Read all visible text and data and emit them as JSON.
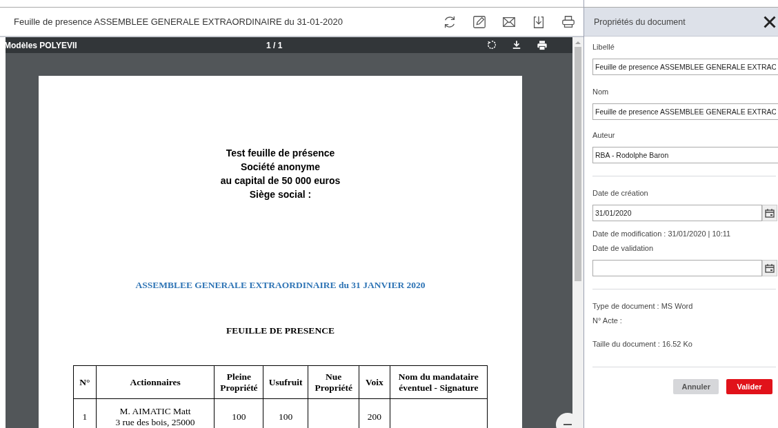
{
  "document_bar": {
    "title": "Feuille de presence ASSEMBLEE GENERALE EXTRAORDINAIRE du 31-01-2020"
  },
  "viewer": {
    "toolbar": {
      "title": "Modèles POLYEVII",
      "page_count": "1 / 1"
    },
    "page": {
      "heading_lines": [
        "Test feuille de présence",
        "Société anonyme",
        "au capital de 50 000 euros",
        "Siège social :"
      ],
      "meeting_title": "ASSEMBLEE GENERALE EXTRAORDINAIRE du 31 JANVIER 2020",
      "sheet_title": "FEUILLE DE PRESENCE",
      "table": {
        "columns": [
          "N°",
          "Actionnaires",
          "Pleine Propriété",
          "Usufruit",
          "Nue Propriété",
          "Voix",
          "Nom du mandataire éventuel - Signature"
        ],
        "rows": [
          {
            "number": "1",
            "shareholder": [
              "M. AIMATIC Matt",
              "3 rue des bois, 25000"
            ],
            "full_ownership": "100",
            "usufruct": "100",
            "votes": "200"
          }
        ]
      }
    }
  },
  "properties": {
    "title": "Propriétés du document",
    "fields": [
      {
        "label": "Libellé",
        "value": "Feuille de presence ASSEMBLEE GENERALE EXTRAC"
      },
      {
        "label": "Nom",
        "value": "Feuille de presence ASSEMBLEE GENERALE EXTRAC"
      },
      {
        "label": "Auteur",
        "value": "RBA - Rodolphe Baron"
      }
    ],
    "creation_date": {
      "label": "Date de création",
      "value": "31/01/2020"
    },
    "modification": "Date de modification : 31/01/2020 | 10:11",
    "validation_date": {
      "label": "Date de validation"
    },
    "info": [
      "Type de document : MS Word",
      "N° Acte :"
    ],
    "size": "Taille du document : 16.52 Ko",
    "buttons": [
      {
        "label": "Annuler",
        "kind": "secondary"
      },
      {
        "label": "Valider",
        "kind": "primary"
      }
    ]
  }
}
